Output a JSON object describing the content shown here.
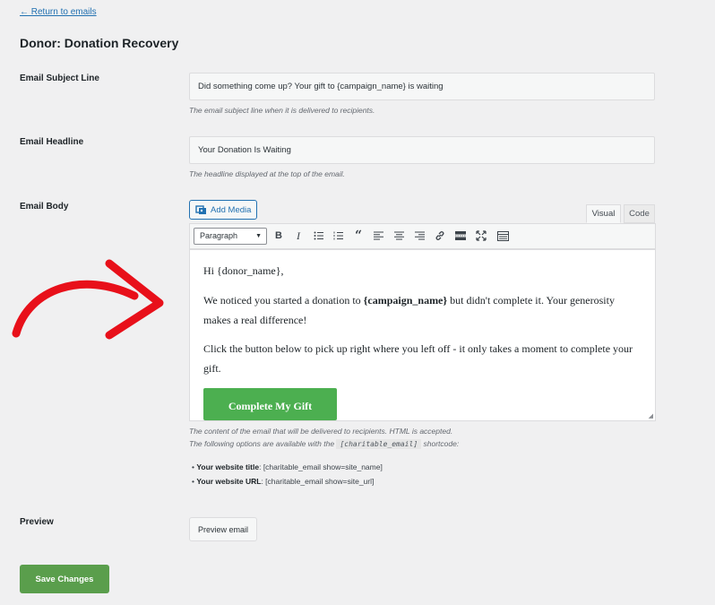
{
  "nav": {
    "back_link": "← Return to emails"
  },
  "page": {
    "title": "Donor: Donation Recovery"
  },
  "fields": {
    "subject": {
      "label": "Email Subject Line",
      "value": "Did something come up? Your gift to {campaign_name} is waiting",
      "description": "The email subject line when it is delivered to recipients."
    },
    "headline": {
      "label": "Email Headline",
      "value": "Your Donation Is Waiting",
      "description": "The headline displayed at the top of the email."
    },
    "body": {
      "label": "Email Body",
      "add_media": "Add Media",
      "tabs": {
        "visual": "Visual",
        "code": "Code"
      },
      "format_select": "Paragraph",
      "content": {
        "greeting": "Hi {donor_name},",
        "p1_before": "We noticed you started a donation to ",
        "p1_bold": "{campaign_name}",
        "p1_after": " but didn't complete it. Your generosity makes a real difference!",
        "p2": "Click the button below to pick up right where you left off - it only takes a moment to complete your gift.",
        "button": "Complete My Gift"
      },
      "description_line1": "The content of the email that will be delivered to recipients. HTML is accepted.",
      "description_line2_before": "The following options are available with the ",
      "description_line2_code": "[charitable_email]",
      "description_line2_after": " shortcode:",
      "shortcodes": [
        {
          "name": "Your website title",
          "code": ": [charitable_email show=site_name]"
        },
        {
          "name": "Your website URL",
          "code": ": [charitable_email show=site_url]"
        }
      ]
    },
    "preview": {
      "label": "Preview",
      "button": "Preview email"
    }
  },
  "actions": {
    "save": "Save Changes"
  },
  "colors": {
    "accent": "#2271b1",
    "save_button": "#5a9e4c",
    "email_button": "#4caf50",
    "arrow": "#e8101a"
  },
  "toolbar_icons": [
    "bold-icon",
    "italic-icon",
    "bullet-list-icon",
    "numbered-list-icon",
    "blockquote-icon",
    "align-left-icon",
    "align-center-icon",
    "align-right-icon",
    "link-icon",
    "read-more-icon",
    "fullscreen-icon",
    "toolbar-toggle-icon"
  ]
}
